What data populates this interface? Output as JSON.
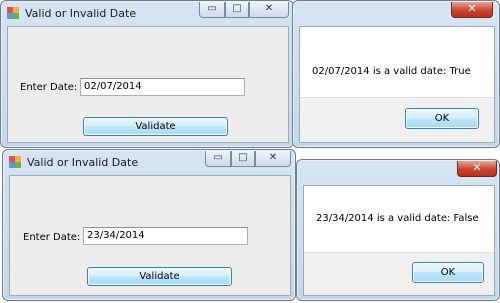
{
  "forms": [
    {
      "title": "Valid or Invalid Date",
      "label": "Enter Date:",
      "input_value": "02/07/2014",
      "button": "Validate"
    },
    {
      "title": "Valid or Invalid Date",
      "label": "Enter Date:",
      "input_value": "23/34/2014",
      "button": "Validate"
    }
  ],
  "messages": [
    {
      "text": "02/07/2014 is a valid date: True",
      "button": "OK"
    },
    {
      "text": "23/34/2014 is a valid date: False",
      "button": "OK"
    }
  ],
  "window_controls": {
    "minimize": "▭",
    "maximize": "□",
    "close": "✕"
  },
  "colors": {
    "close": "#c7452f",
    "accent": "#3c7fb1",
    "titlebar": "#c4d6ea"
  }
}
